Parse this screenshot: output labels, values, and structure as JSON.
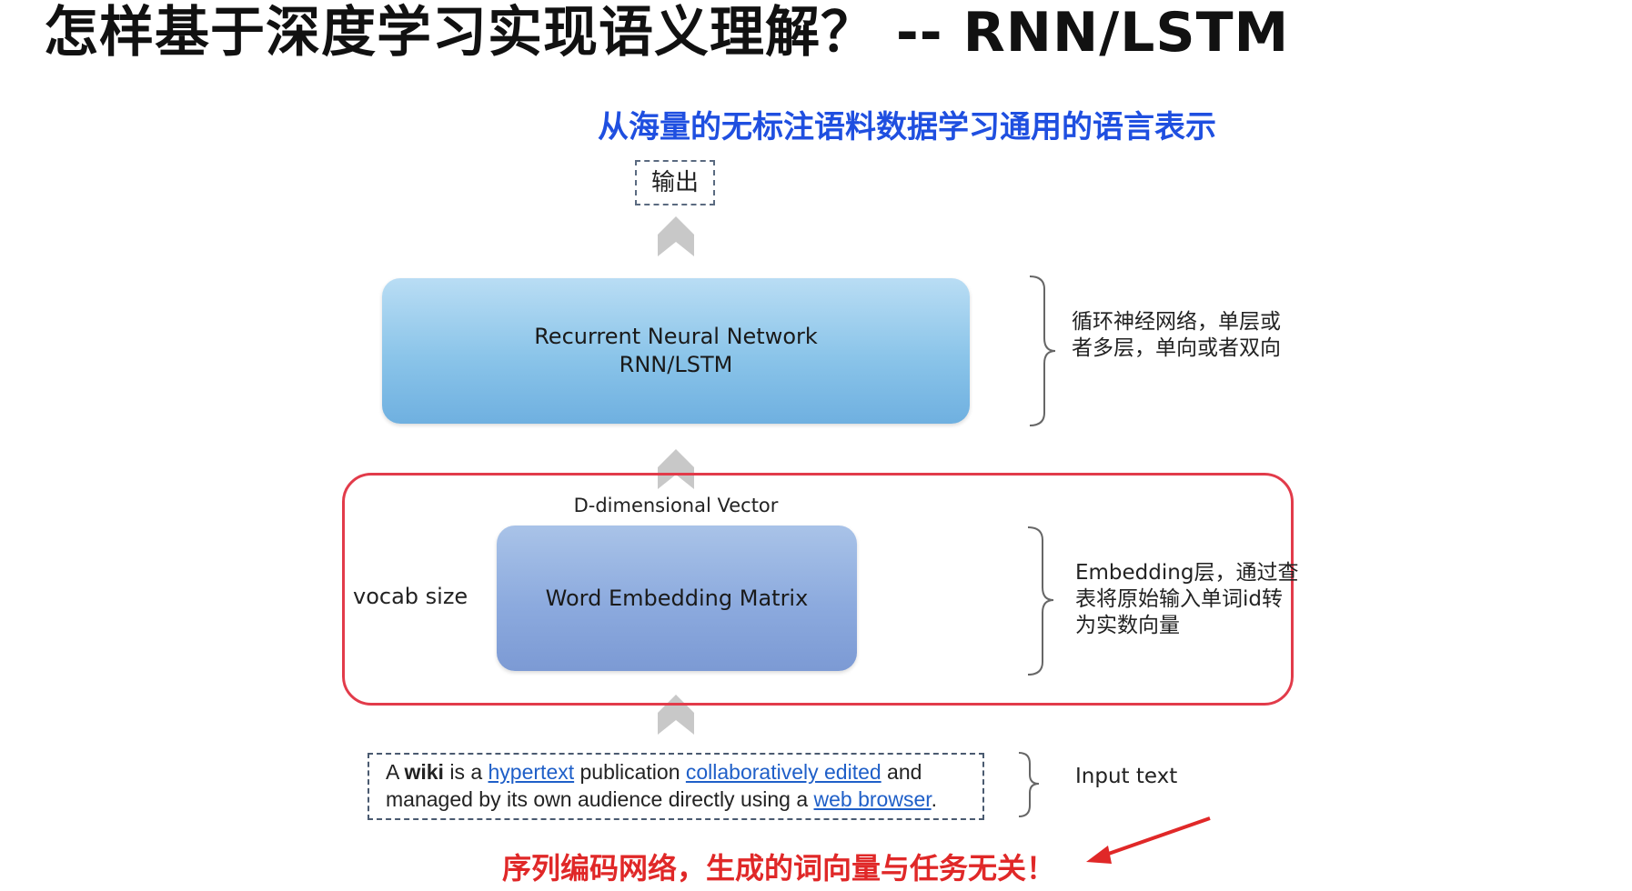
{
  "title": "怎样基于深度学习实现语义理解？  -- RNN/LSTM",
  "subtitle": "从海量的无标注语料数据学习通用的语言表示",
  "diagram": {
    "output_label": "输出",
    "rnn_block": {
      "line1": "Recurrent Neural Network",
      "line2": "RNN/LSTM",
      "note": "循环神经网络，单层或者多层，单向或者双向"
    },
    "embedding_block": {
      "label": "Word Embedding Matrix",
      "top_dimension_label": "D-dimensional Vector",
      "side_dimension_label": "vocab size",
      "note": "Embedding层，通过查表将原始输入单词id转为实数向量"
    },
    "input_text": {
      "line1": [
        {
          "text": "A ",
          "style": "plain"
        },
        {
          "text": "wiki",
          "style": "bold"
        },
        {
          "text": " is a ",
          "style": "plain"
        },
        {
          "text": "hypertext",
          "style": "link"
        },
        {
          "text": " publication ",
          "style": "plain"
        },
        {
          "text": "collaboratively edited",
          "style": "link"
        },
        {
          "text": " and",
          "style": "plain"
        }
      ],
      "line2": [
        {
          "text": "managed by its own audience directly using a ",
          "style": "plain"
        },
        {
          "text": "web browser",
          "style": "link"
        },
        {
          "text": ".",
          "style": "plain"
        }
      ],
      "note": "Input text"
    },
    "conclusion": "序列编码网络，生成的词向量与任务无关！"
  },
  "colors": {
    "subtitle": "#1f4fe0",
    "conclusion": "#e02828",
    "region_border": "#e23b4a",
    "link": "#1f5fc8",
    "rnn_fill": "#8ac4e9",
    "embedding_fill": "#8caade",
    "arrow_fill": "#c8c8c8"
  }
}
